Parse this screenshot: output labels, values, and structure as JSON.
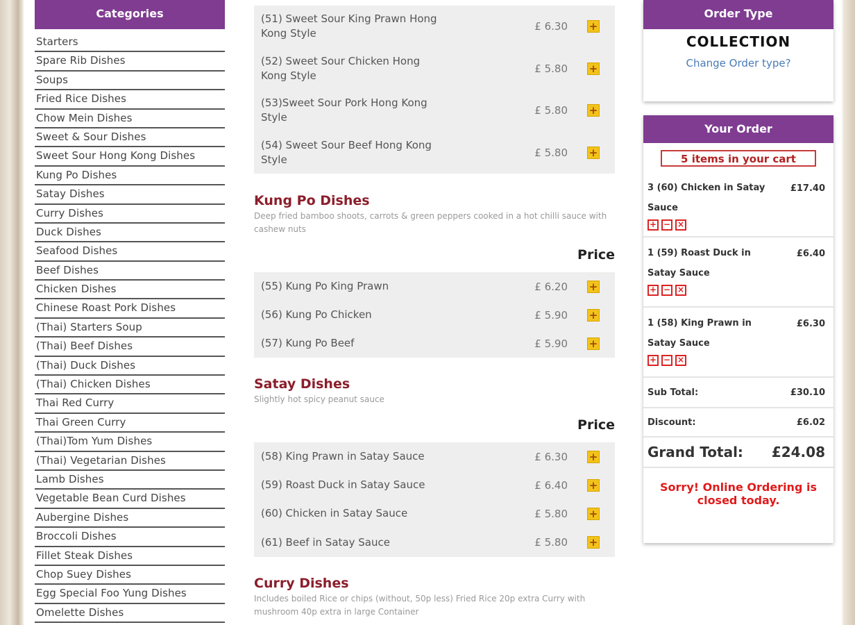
{
  "categories": {
    "title": "Categories",
    "items": [
      "Starters",
      "Spare Rib Dishes",
      "Soups",
      "Fried Rice Dishes",
      "Chow Mein Dishes",
      "Sweet & Sour Dishes",
      "Sweet Sour Hong Kong Dishes",
      "Kung Po Dishes",
      "Satay Dishes",
      "Curry Dishes",
      "Duck Dishes",
      "Seafood Dishes",
      "Beef Dishes",
      "Chicken Dishes",
      "Chinese Roast Pork Dishes",
      "(Thai) Starters Soup",
      "(Thai) Beef Dishes",
      "(Thai) Duck Dishes",
      "(Thai) Chicken Dishes",
      "Thai Red Curry",
      "Thai Green Curry",
      "(Thai)Tom Yum Dishes",
      "(Thai) Vegetarian Dishes",
      "Lamb Dishes",
      "Vegetable Bean Curd Dishes",
      "Aubergine Dishes",
      "Broccoli Dishes",
      "Fillet Steak Dishes",
      "Chop Suey Dishes",
      "Egg Special Foo Yung Dishes",
      "Omelette Dishes"
    ]
  },
  "menu": {
    "hongkong_items": [
      {
        "name": "(51) Sweet Sour King Prawn Hong Kong Style",
        "price": "£ 6.30"
      },
      {
        "name": "(52) Sweet Sour Chicken Hong Kong Style",
        "price": "£ 5.80"
      },
      {
        "name": "(53)Sweet Sour Pork Hong Kong Style",
        "price": "£ 5.80"
      },
      {
        "name": "(54) Sweet Sour Beef Hong Kong Style",
        "price": "£ 5.80"
      }
    ],
    "add_symbol": "+",
    "price_header": "Price",
    "kungpo": {
      "title": "Kung Po Dishes",
      "desc": "Deep fried bamboo shoots, carrots & green peppers cooked in a hot chilli sauce with cashew nuts",
      "items": [
        {
          "name": "(55) Kung Po King Prawn",
          "price": "£ 6.20"
        },
        {
          "name": "(56) Kung Po Chicken",
          "price": "£ 5.90"
        },
        {
          "name": "(57) Kung Po Beef",
          "price": "£ 5.90"
        }
      ]
    },
    "satay": {
      "title": "Satay Dishes",
      "desc": "Slightly hot spicy peanut sauce",
      "items": [
        {
          "name": "(58) King Prawn in Satay Sauce",
          "price": "£ 6.30"
        },
        {
          "name": "(59) Roast Duck in Satay Sauce",
          "price": "£ 6.40"
        },
        {
          "name": "(60) Chicken in Satay Sauce",
          "price": "£ 5.80"
        },
        {
          "name": "(61) Beef in Satay Sauce",
          "price": "£ 5.80"
        }
      ]
    },
    "curry": {
      "title": "Curry Dishes",
      "desc": "Includes boiled Rice or chips (without, 50p less) Fried Rice 20p extra Curry with mushroom 40p extra in large Container"
    }
  },
  "order_type": {
    "title": "Order Type",
    "value": "COLLECTION",
    "change_link": "Change Order type?"
  },
  "your_order": {
    "title": "Your Order",
    "cart_count": "5 items in your cart",
    "items": [
      {
        "name": "3 (60) Chicken in Satay Sauce",
        "price": "£17.40"
      },
      {
        "name": "1 (59) Roast Duck in Satay Sauce",
        "price": "£6.40"
      },
      {
        "name": "1 (58) King Prawn in Satay Sauce",
        "price": "£6.30"
      }
    ],
    "ctrl_add": "+",
    "ctrl_remove": "−",
    "ctrl_delete": "×",
    "subtotal_label": "Sub Total:",
    "subtotal": "£30.10",
    "discount_label": "Discount:",
    "discount": "£6.02",
    "grand_label": "Grand Total:",
    "grand": "£24.08",
    "closed_msg": "Sorry! Online Ordering is closed today."
  }
}
